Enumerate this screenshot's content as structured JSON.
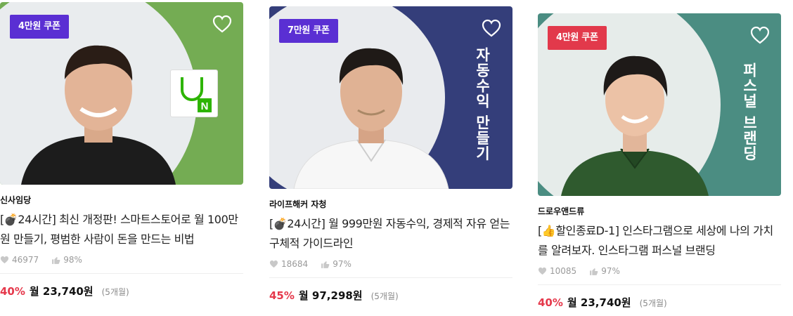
{
  "cards": [
    {
      "coupon": "4만원 쿠폰",
      "coupon_color": "#5a2fd3",
      "bg_color": "#74ac53",
      "circle_color": "#e9ecee",
      "creator": "신사임당",
      "title": "[💣24시간] 최신 개정판! 스마트스토어로 월 100만원 만들기, 평범한 사람이 돈을 만드는 비법",
      "likes": "46977",
      "satisfaction": "98%",
      "discount": "40%",
      "price": "월 23,740원",
      "months": "(5개월)",
      "badge_icon": "naver-n-logo"
    },
    {
      "coupon": "7만원 쿠폰",
      "coupon_color": "#5a2fd3",
      "bg_color": "#343e7a",
      "circle_color": "#e9ebee",
      "creator": "라이프해커 자청",
      "title": "[💣24시간] 월 999만원 자동수익, 경제적 자유 얻는 구체적 가이드라인",
      "likes": "18684",
      "satisfaction": "97%",
      "discount": "45%",
      "price": "월 97,298원",
      "months": "(5개월)",
      "vertical_text": "자동수익 만들기"
    },
    {
      "coupon": "4만원 쿠폰",
      "coupon_color": "#e2394b",
      "bg_color": "#4b8d82",
      "circle_color": "#e6ecea",
      "creator": "드로우앤드류",
      "title": "[👍할인종료D-1] 인스타그램으로 세상에 나의 가치를 알려보자. 인스타그램 퍼스널 브랜딩",
      "likes": "10085",
      "satisfaction": "97%",
      "discount": "40%",
      "price": "월 23,740원",
      "months": "(5개월)",
      "vertical_text": "퍼스널 브랜딩"
    }
  ]
}
